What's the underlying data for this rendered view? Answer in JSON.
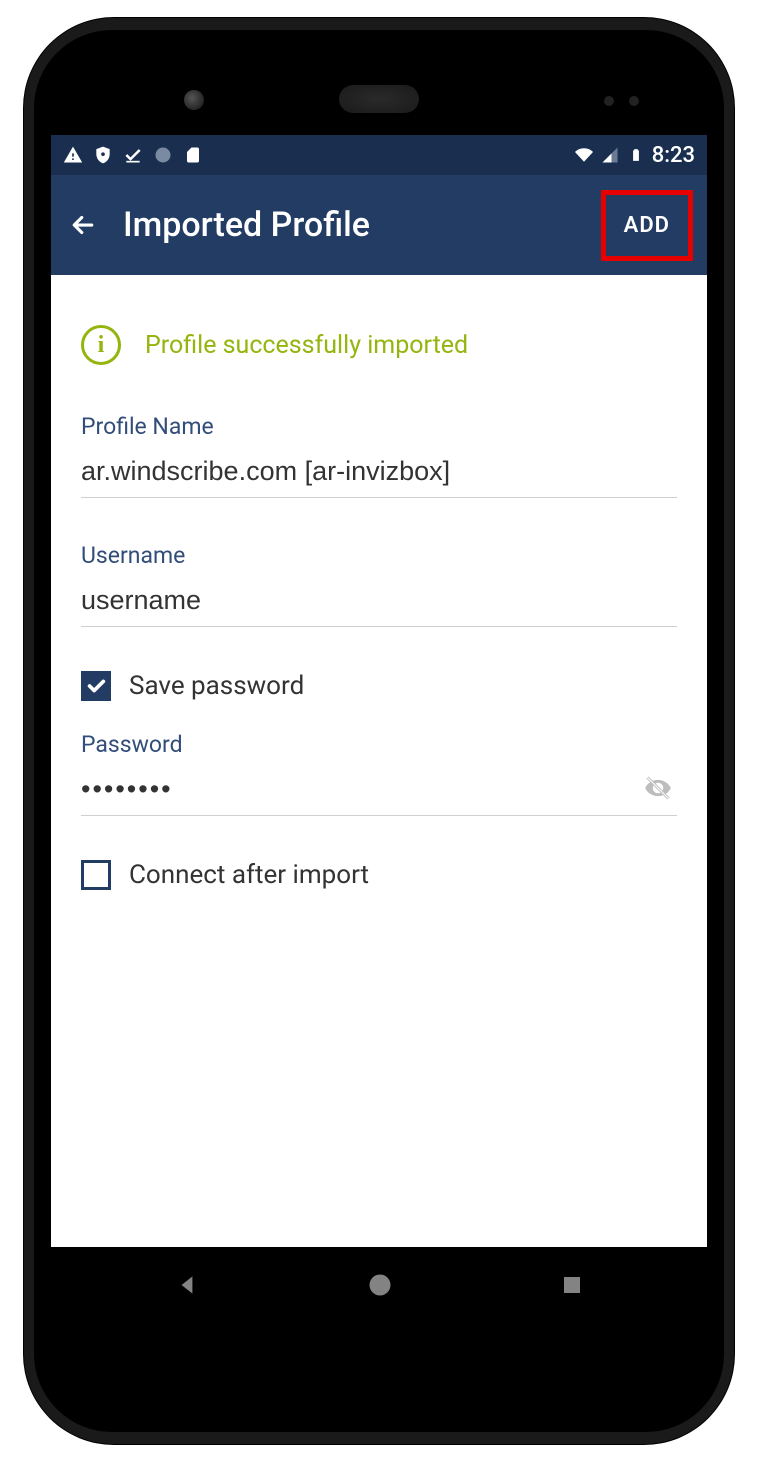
{
  "status_bar": {
    "time": "8:23"
  },
  "app_bar": {
    "title": "Imported Profile",
    "add_label": "ADD"
  },
  "success_message": "Profile successfully imported",
  "fields": {
    "profile_name": {
      "label": "Profile Name",
      "value": "ar.windscribe.com [ar-invizbox]"
    },
    "username": {
      "label": "Username",
      "value": "username"
    },
    "save_password": {
      "label": "Save password",
      "checked": true
    },
    "password": {
      "label": "Password",
      "value": "••••••••"
    },
    "connect_after_import": {
      "label": "Connect after import",
      "checked": false
    }
  }
}
